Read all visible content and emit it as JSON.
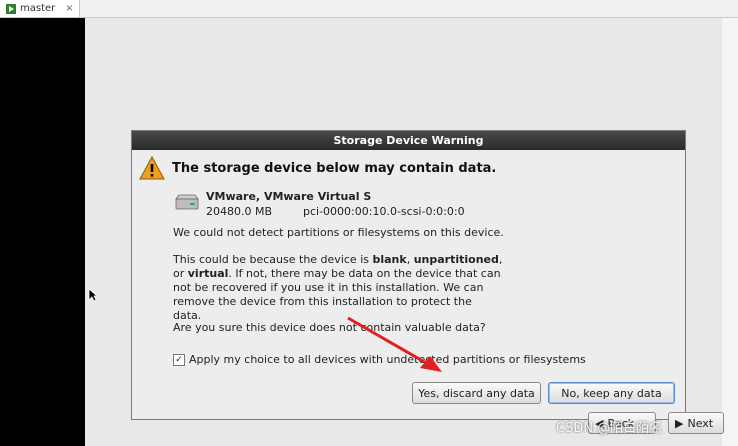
{
  "tab": {
    "label": "master",
    "close": "×",
    "icon": "vm-play-icon"
  },
  "dialog": {
    "title": "Storage Device Warning",
    "heading": "The storage device below may contain data.",
    "device": {
      "name": "VMware, VMware Virtual S",
      "size": "20480.0 MB",
      "path": "pci-0000:00:10.0-scsi-0:0:0:0"
    },
    "p1": "We could not detect partitions or filesystems on this device.",
    "p2_a": "This could be because the device is ",
    "p2_blank": "blank",
    "p2_comma": ", ",
    "p2_unpart": "unpartitioned",
    "p2_b": ",",
    "p2_or": "or ",
    "p2_virtual": "virtual",
    "p2_c": ". If not, there may be data on the device that can not be recovered if you use it in this installation. We can remove the device from this installation to protect the data.",
    "p3": "Are you sure this device does not contain valuable data?",
    "apply_checked": "✓",
    "apply_label": "Apply my choice to all devices with undetected partitions or filesystems",
    "discard_label": "Yes, discard any data",
    "keep_label": "No, keep any data"
  },
  "nav": {
    "back_label": "Back",
    "next_label": "Next"
  },
  "watermark": "CSDN @陌白陌名",
  "colors": {
    "warning": "#f0a020",
    "annotation_arrow": "#e02020"
  }
}
